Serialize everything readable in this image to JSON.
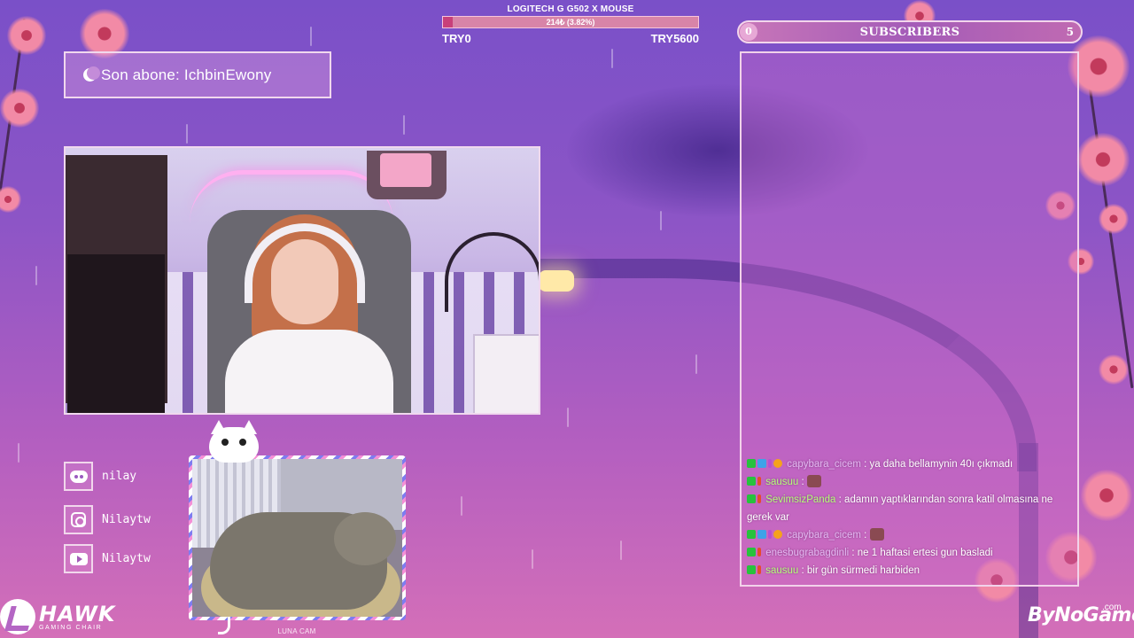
{
  "goal": {
    "title": "LOGITECH G G502 X MOUSE",
    "progress_text": "214₺ (3.82%)",
    "progress_fraction": 0.0382,
    "min_label": "TRY0",
    "max_label": "TRY5600"
  },
  "subscribers": {
    "min": "0",
    "label": "SUBSCRIBERS",
    "max": "5"
  },
  "last_sub": {
    "text": "Son abone: IchbinEwony"
  },
  "chat": {
    "messages": [
      {
        "user": "capybara_cicem",
        "user_color": "#e4b9f2",
        "text": ": ya daha bellamynin 40ı çıkmadı",
        "badges": [
          "green",
          "blue",
          "bits",
          "orange"
        ]
      },
      {
        "user": "sausuu",
        "user_color": "#b6ff7a",
        "text": ": ",
        "badges": [
          "green",
          "red"
        ],
        "emote": true
      },
      {
        "user": "SevimsizPanda",
        "user_color": "#b6ff7a",
        "text": ": adamın yaptıklarından sonra katil olmasına ne gerek var",
        "badges": [
          "green",
          "red"
        ]
      },
      {
        "user": "capybara_cicem",
        "user_color": "#e4b9f2",
        "text": ": ",
        "badges": [
          "green",
          "blue",
          "bits",
          "orange"
        ],
        "emote": true
      },
      {
        "user": "enesbugrabagdinli",
        "user_color": "#e4b9f2",
        "text": ": ne 1 haftasi ertesi gun basladi",
        "badges": [
          "green",
          "red"
        ]
      },
      {
        "user": "sausuu",
        "user_color": "#b6ff7a",
        "text": ": bir gün sürmedi harbiden",
        "badges": [
          "green",
          "red"
        ]
      }
    ]
  },
  "socials": [
    {
      "icon": "discord-icon",
      "label": "nilay"
    },
    {
      "icon": "instagram-icon",
      "label": "Nilaytw"
    },
    {
      "icon": "youtube-icon",
      "label": "Nilaytw"
    }
  ],
  "cat_cam": {
    "label": "LUNA CAM"
  },
  "sponsors": {
    "hawk_name": "HAWK",
    "hawk_sub": "GAMING CHAIR",
    "bynogame": "ByNoGame",
    "bynogame_com": ".com"
  },
  "colors": {
    "accent": "#c8407a",
    "frame": "#f1d7ec"
  }
}
